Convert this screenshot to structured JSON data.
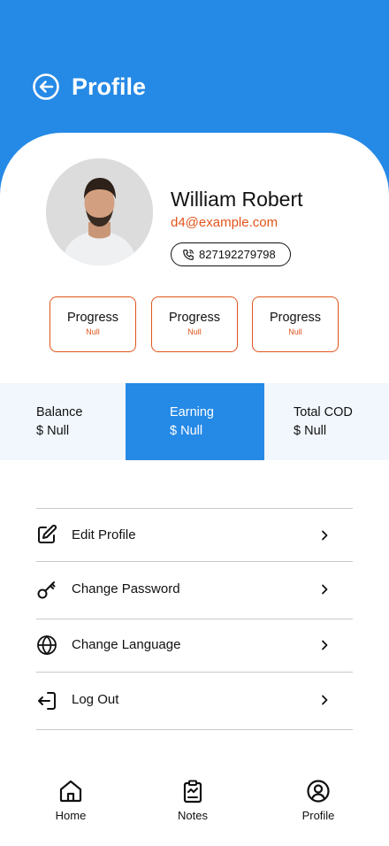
{
  "header": {
    "title": "Profile",
    "back_icon": "arrow-left-circle-icon",
    "background": "#2589e6"
  },
  "user": {
    "name": "William Robert",
    "email": "d4@example.com",
    "phone": "827192279798"
  },
  "colors": {
    "accent": "#e0541a",
    "primary": "#2589e6",
    "panel": "#f2f7fd"
  },
  "stats": [
    {
      "label": "Progress",
      "value": "Null"
    },
    {
      "label": "Progress",
      "value": "Null"
    },
    {
      "label": "Progress",
      "value": "Null"
    }
  ],
  "finance": [
    {
      "label": "Balance",
      "value": "$ Null",
      "active": false
    },
    {
      "label": "Earning",
      "value": "$ Null",
      "active": true
    },
    {
      "label": "Total COD",
      "value": "$ Null",
      "active": false
    }
  ],
  "menu": [
    {
      "label": "Edit Profile",
      "icon": "edit-icon"
    },
    {
      "label": "Change Password",
      "icon": "key-icon"
    },
    {
      "label": "Change Language",
      "icon": "globe-icon"
    },
    {
      "label": "Log Out",
      "icon": "logout-icon"
    }
  ],
  "nav": [
    {
      "label": "Home",
      "icon": "home-icon"
    },
    {
      "label": "Notes",
      "icon": "clipboard-icon"
    },
    {
      "label": "Profile",
      "icon": "user-circle-icon"
    }
  ]
}
